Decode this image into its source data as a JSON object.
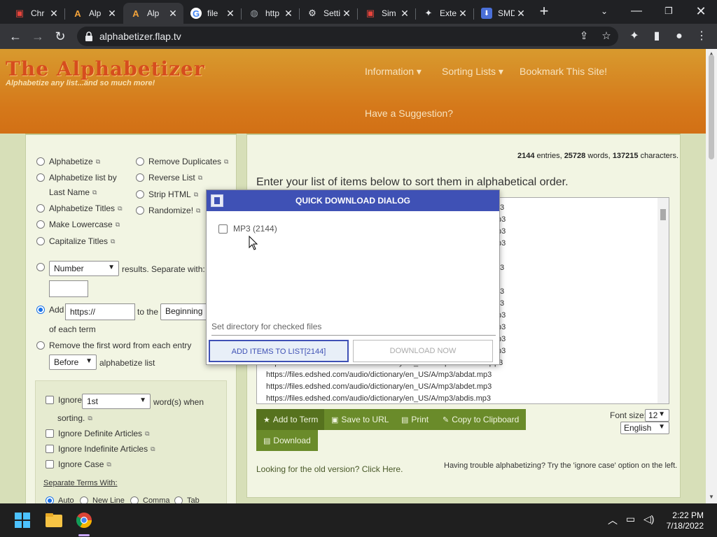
{
  "browser": {
    "tabs": [
      {
        "label": "Chr",
        "favicon": "gallery-icon",
        "color": "#e8453c"
      },
      {
        "label": "Alp",
        "favicon": "a-logo-icon",
        "color": "#f3a33a"
      },
      {
        "label": "Alp",
        "favicon": "a-logo-icon",
        "color": "#f3a33a",
        "active": true
      },
      {
        "label": "file",
        "favicon": "google-icon",
        "color": "#4285f4"
      },
      {
        "label": "http",
        "favicon": "globe-icon",
        "color": "#9aa0a6"
      },
      {
        "label": "Setti",
        "favicon": "gear-icon",
        "color": "#e8eaed"
      },
      {
        "label": "Sim",
        "favicon": "gallery-icon",
        "color": "#e8453c"
      },
      {
        "label": "Exte",
        "favicon": "puzzle-icon",
        "color": "#e8eaed"
      },
      {
        "label": "SMD Q",
        "favicon": "download-icon",
        "color": "#4a6fd8"
      }
    ],
    "url": "alphabetizer.flap.tv"
  },
  "site": {
    "logo": "The Alphabetizer",
    "tagline": "Alphabetize any list...and so much more!",
    "nav": {
      "information": "Information ▾",
      "sorting_lists": "Sorting Lists ▾",
      "bookmark": "Bookmark This Site!",
      "suggestion": "Have a Suggestion?"
    }
  },
  "left": {
    "options_col1": [
      "Alphabetize",
      "Alphabetize list by",
      "Last Name",
      "Alphabetize Titles",
      "Make Lowercase",
      "Capitalize Titles"
    ],
    "options_col2": [
      "Remove Duplicates",
      "Reverse List",
      "Strip HTML",
      "Randomize!"
    ],
    "number_select": "Number",
    "results_text": "results. Separate with:",
    "add_label": "Add",
    "add_value": "https://",
    "to_the": "to the",
    "position_select": "Beginning",
    "of_each_term": "of each term",
    "remove_first_word": "Remove the first word from each entry",
    "before_select": "Before",
    "alphabetize_list": "alphabetize list",
    "ignore_label": "Ignore",
    "ignore_select": "1st",
    "words_when": "word(s) when",
    "sorting": "sorting.",
    "ignore_definite": "Ignore Definite Articles",
    "ignore_indefinite": "Ignore Indefinite Articles",
    "ignore_case": "Ignore Case",
    "separate_terms": "Separate Terms With:",
    "separators": [
      "Auto",
      "New Line",
      "Comma",
      "Tab"
    ]
  },
  "right": {
    "stats": {
      "entries": "2144",
      "entries_label": "entries,",
      "words": "25728",
      "words_label": "words,",
      "chars": "137215",
      "chars_label": "characters."
    },
    "instruction": "Enter your list of items below to sort them in alphabetical order.",
    "list_right_fragments": [
      "3",
      "p3",
      "p3",
      "p3",
      "3",
      "3",
      "3",
      "p3",
      "p3",
      "p3",
      "p3",
      "p3"
    ],
    "list_visible": [
      "https://files.edshed.com/audio/dictionary/en_US/A/mp3/abdabs.mp3",
      "https://files.edshed.com/audio/dictionary/en_US/A/mp3/abdat.mp3",
      "https://files.edshed.com/audio/dictionary/en_US/A/mp3/abdet.mp3",
      "https://files.edshed.com/audio/dictionary/en_US/A/mp3/abdis.mp3"
    ],
    "buttons": {
      "add_to_term": "Add to Term",
      "save_to_url": "Save to URL",
      "print": "Print",
      "copy": "Copy to Clipboard",
      "download": "Download"
    },
    "font_size_label": "Font size:",
    "font_size": "12",
    "language": "English",
    "old_version": "Looking for the old version? Click Here.",
    "trouble": "Having trouble alphabetizing? Try the 'ignore case' option on the left."
  },
  "dialog": {
    "title": "QUICK DOWNLOAD DIALOG",
    "mp3_option": "MP3 (2144)",
    "directory_placeholder": "Set directory for checked files",
    "add_items": "ADD ITEMS TO LIST[2144]",
    "download_now": "DOWNLOAD NOW"
  },
  "taskbar": {
    "time": "2:22 PM",
    "date": "7/18/2022"
  }
}
